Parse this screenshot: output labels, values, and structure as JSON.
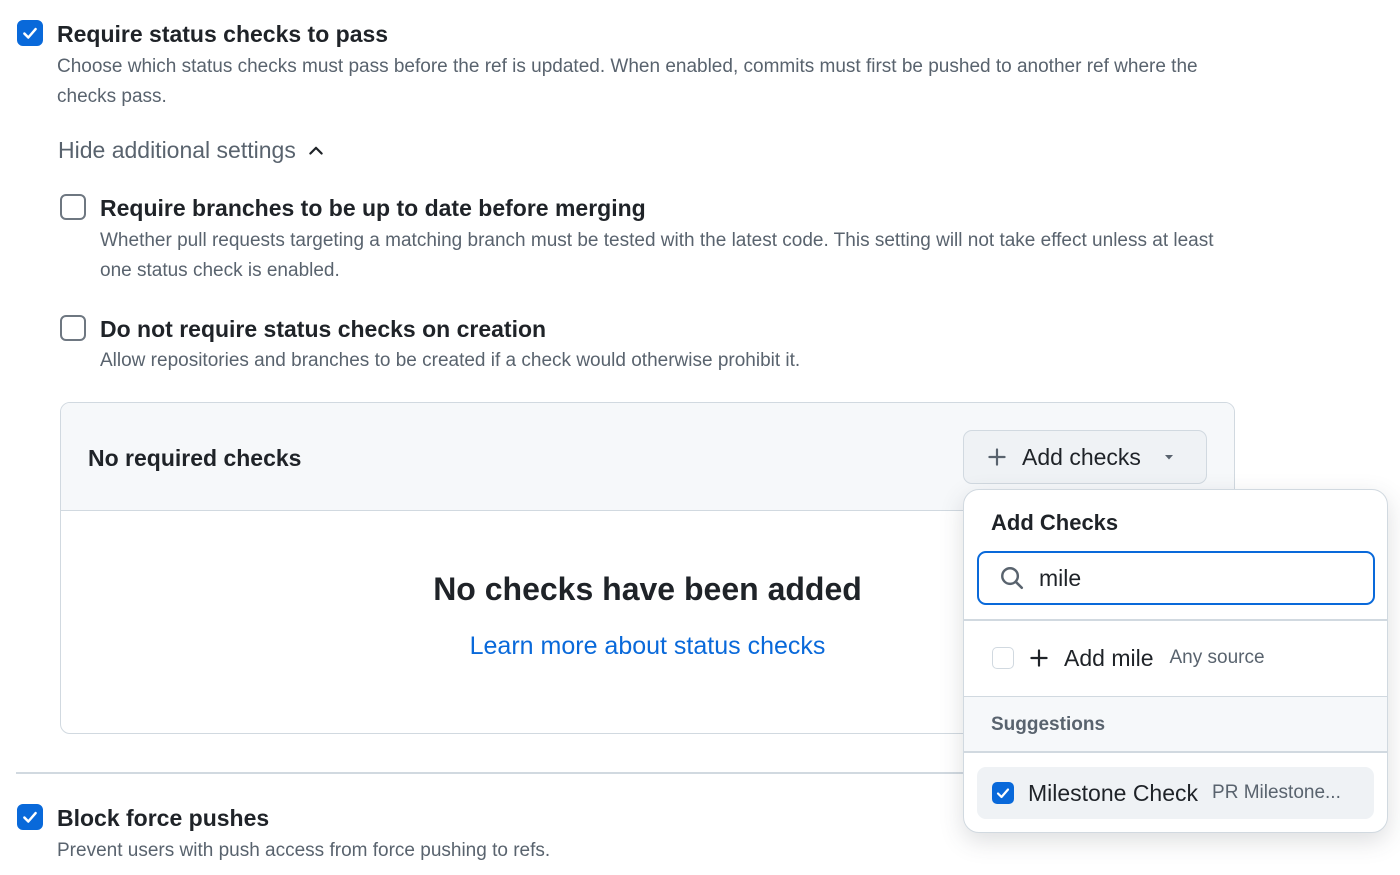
{
  "require_status": {
    "title": "Require status checks to pass",
    "description": "Choose which status checks must pass before the ref is updated. When enabled, commits must first be pushed to another ref where the checks pass.",
    "checked": true
  },
  "toggle_settings": {
    "label": "Hide additional settings",
    "icon": "chevron-up-icon"
  },
  "up_to_date": {
    "title": "Require branches to be up to date before merging",
    "description": "Whether pull requests targeting a matching branch must be tested with the latest code. This setting will not take effect unless at least one status check is enabled.",
    "checked": false
  },
  "on_creation": {
    "title": "Do not require status checks on creation",
    "description": "Allow repositories and branches to be created if a check would otherwise prohibit it.",
    "checked": false
  },
  "checks_panel": {
    "header": "No required checks",
    "add_button": "Add checks",
    "empty_title": "No checks have been added",
    "learn_link": "Learn more about status checks"
  },
  "block_force": {
    "title": "Block force pushes",
    "description": "Prevent users with push access from force pushing to refs.",
    "checked": true
  },
  "popover": {
    "title": "Add Checks",
    "search_value": "mile",
    "add_item_label": "Add mile",
    "add_item_source": "Any source",
    "suggestions_header": "Suggestions",
    "suggestions": [
      {
        "name": "Milestone Check",
        "source": "PR Milestone...",
        "checked": true
      }
    ]
  },
  "colors": {
    "accent": "#0969da",
    "muted_text": "#59636e",
    "border": "#d1d9e0"
  }
}
